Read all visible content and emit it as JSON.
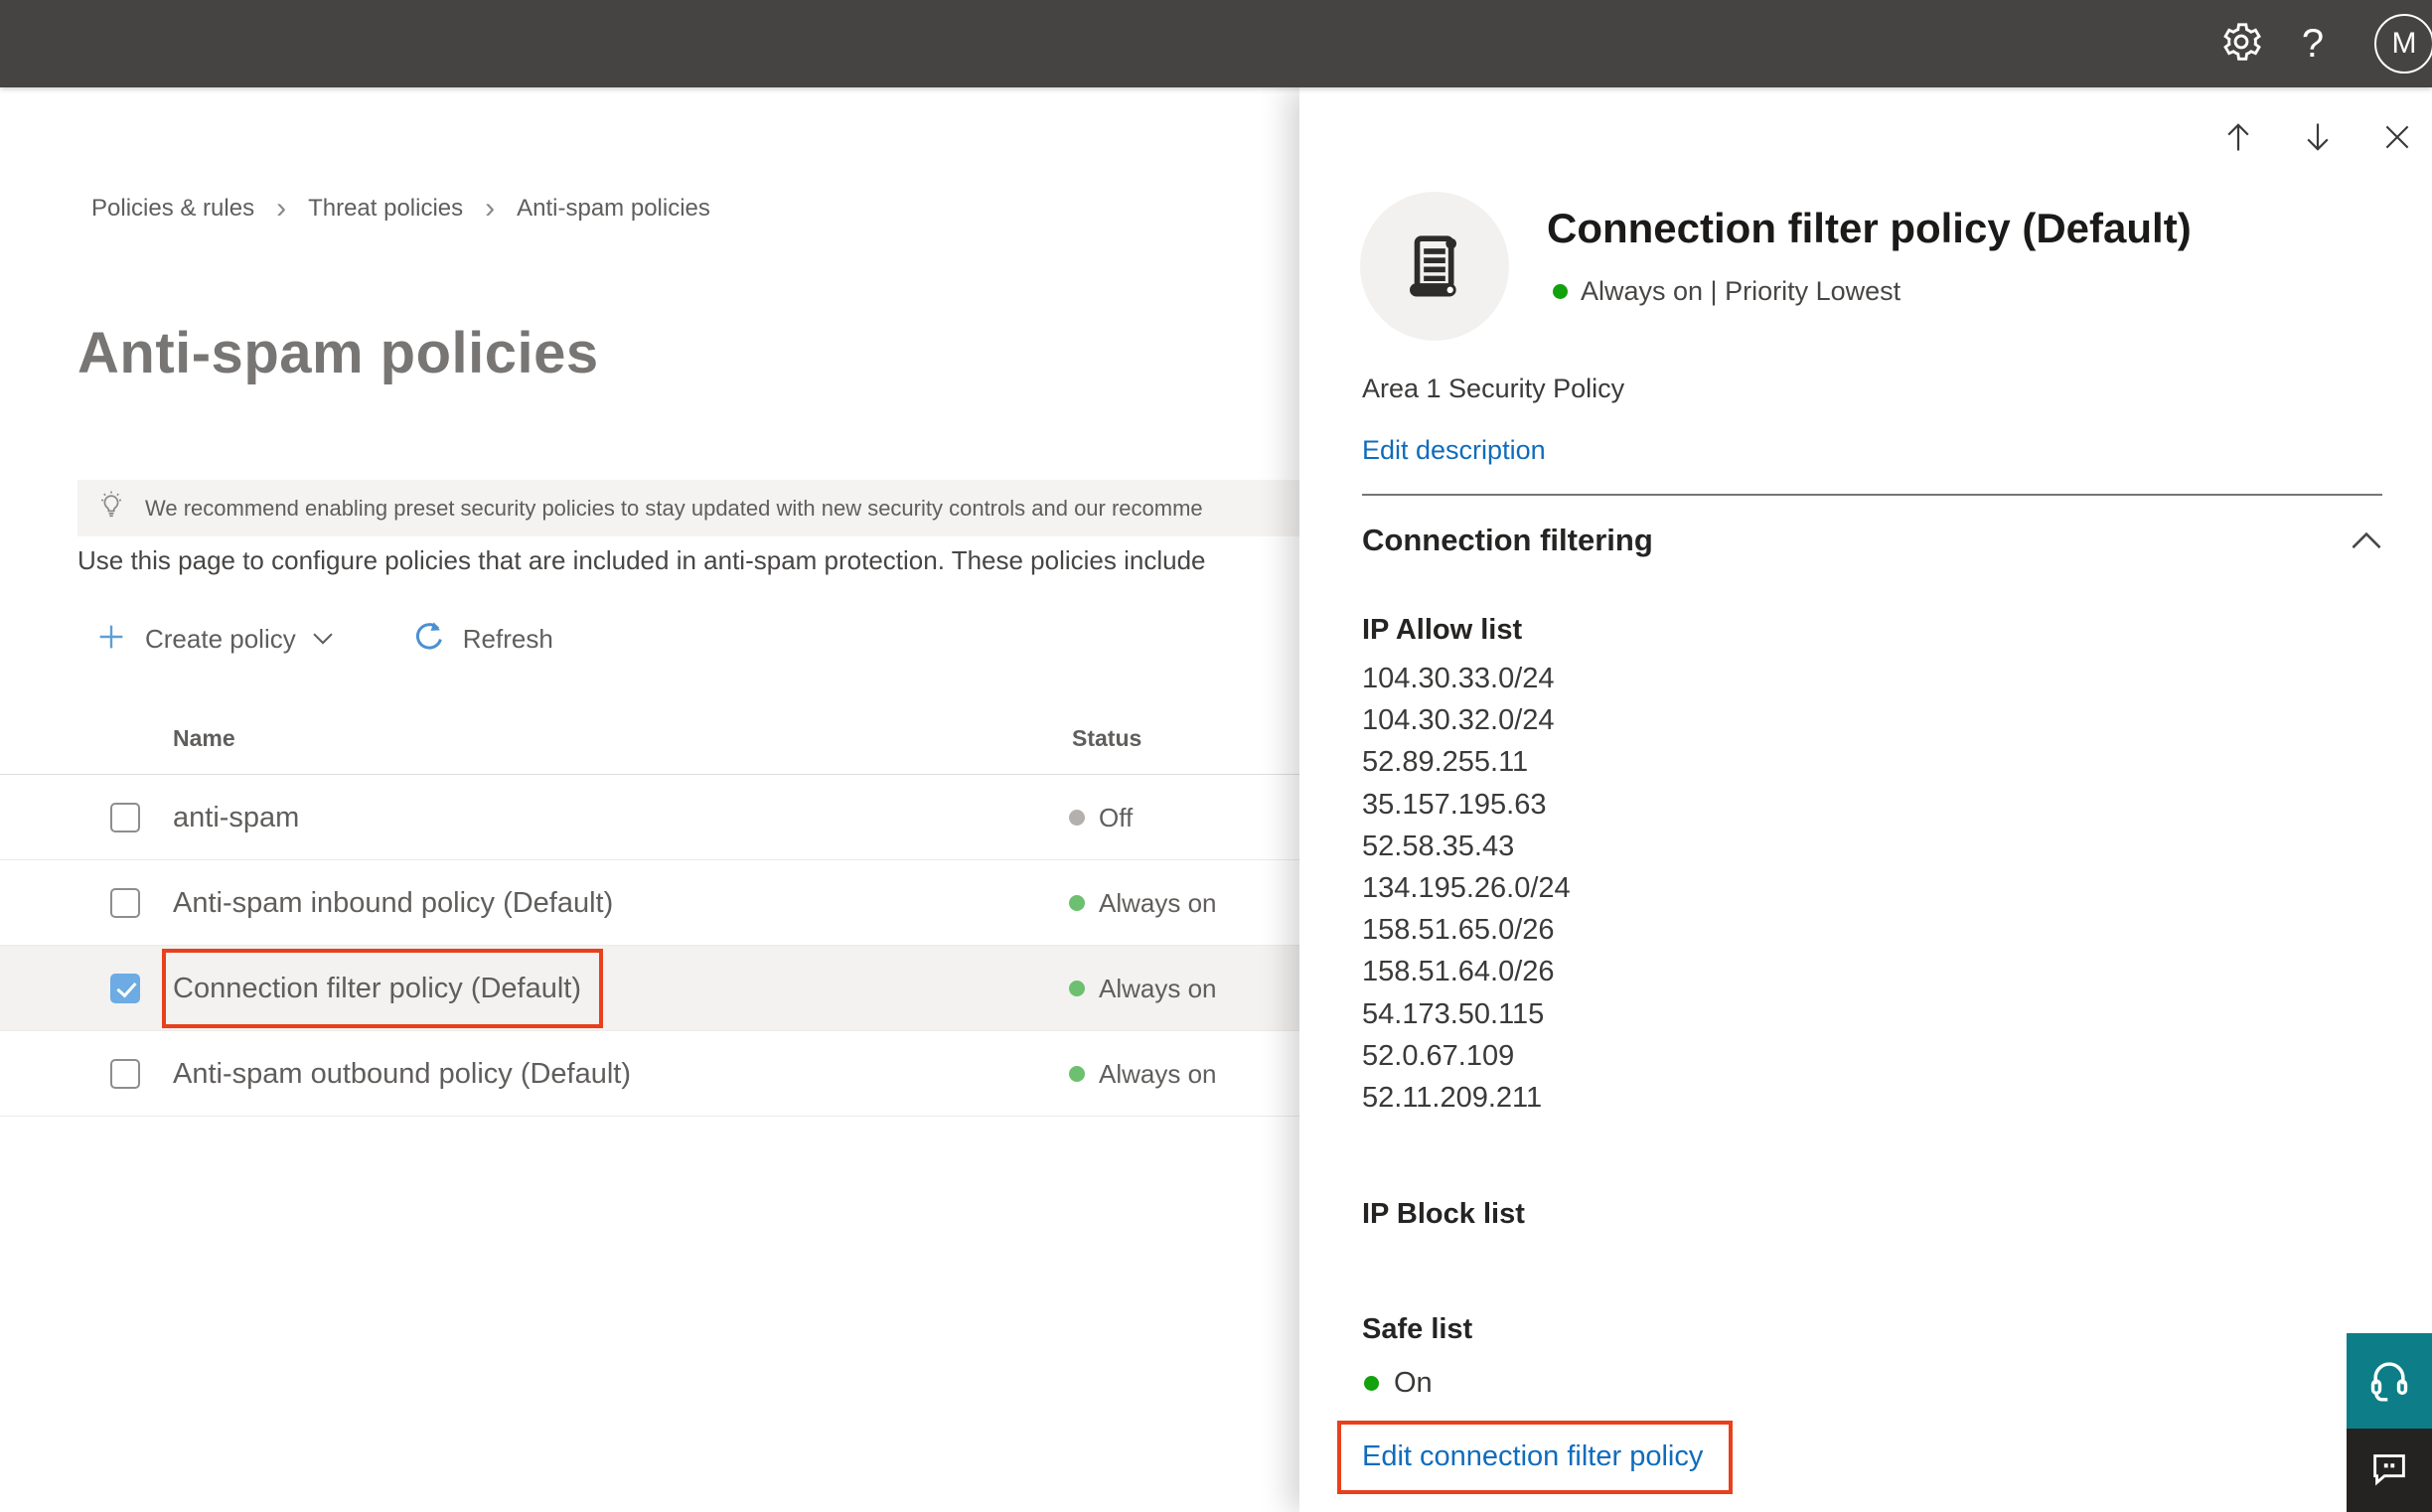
{
  "topbar": {
    "avatar_initial": "M"
  },
  "breadcrumb": {
    "separator": "›",
    "items": [
      "Policies & rules",
      "Threat policies",
      "Anti-spam policies"
    ]
  },
  "page": {
    "title": "Anti-spam policies",
    "banner_text": "We recommend enabling preset security policies to stay updated with new security controls and our recomme",
    "description": "Use this page to configure policies that are included in anti-spam protection. These policies include"
  },
  "toolbar": {
    "create_label": "Create policy",
    "refresh_label": "Refresh"
  },
  "table": {
    "columns": {
      "name": "Name",
      "status": "Status"
    },
    "rows": [
      {
        "name": "anti-spam",
        "status": "Off",
        "dot_class": "dot off",
        "row_class": "table-row",
        "checkbox_class": "checkbox"
      },
      {
        "name": "Anti-spam inbound policy (Default)",
        "status": "Always on",
        "dot_class": "dot on",
        "row_class": "table-row",
        "checkbox_class": "checkbox"
      },
      {
        "name": "Connection filter policy (Default)",
        "status": "Always on",
        "dot_class": "dot on",
        "row_class": "table-row selected",
        "checkbox_class": "checkbox checked"
      },
      {
        "name": "Anti-spam outbound policy (Default)",
        "status": "Always on",
        "dot_class": "dot on",
        "row_class": "table-row",
        "checkbox_class": "checkbox"
      }
    ]
  },
  "flyout": {
    "title": "Connection filter policy (Default)",
    "status_line": "Always on | Priority Lowest",
    "description": "Area 1 Security Policy",
    "edit_description_label": "Edit description",
    "section_title": "Connection filtering",
    "ip_allow_title": "IP Allow list",
    "ip_allow": [
      "104.30.33.0/24",
      "104.30.32.0/24",
      "52.89.255.11",
      "35.157.195.63",
      "52.58.35.43",
      "134.195.26.0/24",
      "158.51.65.0/26",
      "158.51.64.0/26",
      "54.173.50.115",
      "52.0.67.109",
      "52.11.209.211"
    ],
    "ip_block_title": "IP Block list",
    "safe_list_title": "Safe list",
    "safe_list_status": "On",
    "edit_link_label": "Edit connection filter policy"
  },
  "colors": {
    "topbar_bg": "#454442",
    "accent_link_blue": "#0f6cbd",
    "checkbox_blue": "#6cabe3",
    "annotation_red": "#e8401c",
    "status_green_soft": "#6cc06f",
    "status_green_bright": "#13a10e",
    "status_gray": "#b3b0ad",
    "support_teal": "#0d7e87",
    "feedback_dark": "#252321"
  }
}
